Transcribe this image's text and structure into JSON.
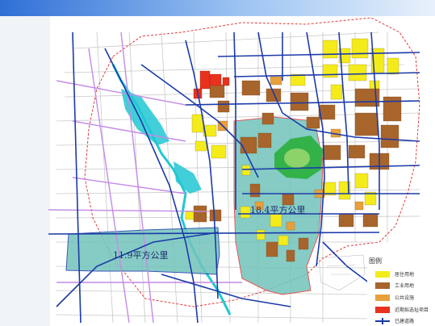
{
  "slide": {
    "top_band_colors": [
      "#2f6fd6",
      "#9cc3f2",
      "#e8f1fb"
    ]
  },
  "map": {
    "area_labels": [
      {
        "id": "large",
        "text": "18.4平方公里"
      },
      {
        "id": "small",
        "text": "11.9平方公里"
      }
    ],
    "colors": {
      "study_area_fill": "#72c4bc",
      "residential": "#f4ec1a",
      "industrial": "#a8652b",
      "public_facility": "#e8a03c",
      "recent_project": "#e8321e",
      "built_road": "#1b3aa8",
      "planned_road": "#c38be6",
      "park": "#33b24a",
      "water": "#22c7d2",
      "boundary": "#e03c3c"
    }
  },
  "legend": {
    "title": "图例",
    "items": [
      {
        "label": "居住用地",
        "color": "#f4ec1a",
        "type": "fill"
      },
      {
        "label": "工业用地",
        "color": "#a8652b",
        "type": "fill"
      },
      {
        "label": "公共设施",
        "color": "#e8a03c",
        "type": "fill"
      },
      {
        "label": "近期拟选址项目",
        "color": "#e8321e",
        "type": "fill"
      },
      {
        "label": "已建道路",
        "color": "#1b3aa8",
        "type": "road"
      }
    ]
  }
}
